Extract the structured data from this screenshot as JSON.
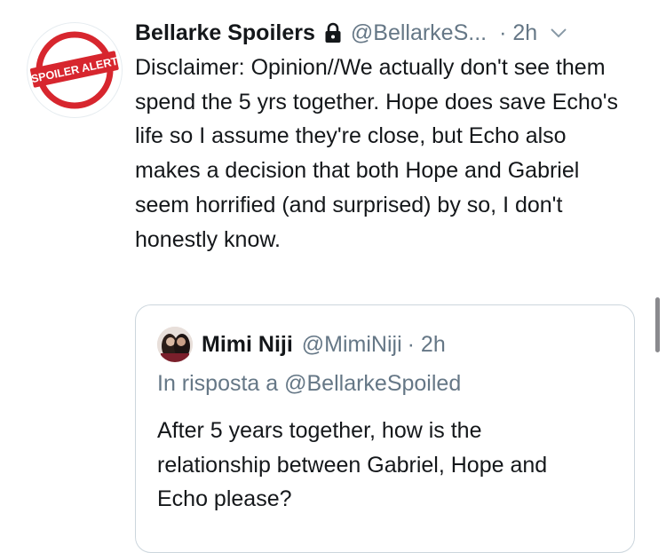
{
  "tweet": {
    "display_name": "Bellarke Spoilers",
    "handle": "@BellarkeS...",
    "time": "· 2h",
    "text": "Disclaimer: Opinion//We actually don't see them spend the 5 yrs together. Hope does save Echo's life so I assume they're close, but Echo also makes a decision that both Hope and Gabriel seem horrified (and surprised) by so, I don't honestly know.",
    "avatar_text": "SPOILER ALERT",
    "icons": {
      "lock": "lock-icon",
      "caret": "chevron-down-icon"
    }
  },
  "quote": {
    "display_name": "Mimi Niji",
    "handle": "@MimiNiji",
    "time": "· 2h",
    "reply_to": "In risposta a @BellarkeSpoiled",
    "text": "After 5 years together, how is the relationship between Gabriel, Hope and Echo please?"
  },
  "colors": {
    "accent_red": "#d7262e",
    "muted": "#657786",
    "text": "#14171a",
    "border": "#ccd6dd"
  }
}
